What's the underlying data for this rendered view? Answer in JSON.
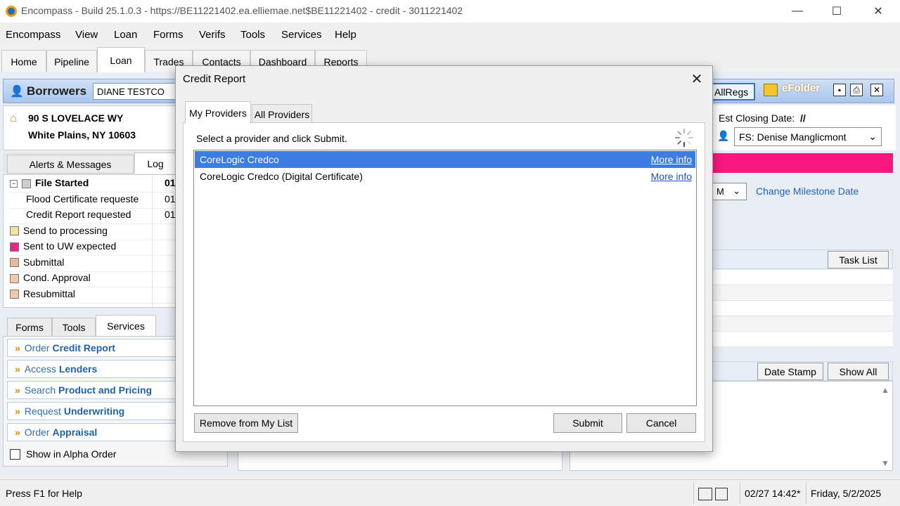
{
  "window": {
    "title": "Encompass - Build 25.1.0.3 - https://BE11221402.ea.elliemae.net$BE11221402 - credit - 3011221402",
    "minimize": "—",
    "maximize": "☐",
    "close": "✕"
  },
  "menu": [
    "Encompass",
    "View",
    "Loan",
    "Forms",
    "Verifs",
    "Tools",
    "Services",
    "Help"
  ],
  "tabs": [
    "Home",
    "Pipeline",
    "Loan",
    "Trades",
    "Contacts",
    "Dashboard",
    "Reports"
  ],
  "active_tab": "Loan",
  "borrowers": {
    "label": "Borrowers",
    "name": "DIANE TESTCO",
    "allregs": "AllRegs",
    "efolder": "eFolder"
  },
  "address": {
    "line1": "90 S LOVELACE WY",
    "line2": "White Plains, NY 10603"
  },
  "log_tabs": [
    "Alerts & Messages",
    "Log"
  ],
  "log_items": [
    {
      "label": "File Started",
      "date": "01",
      "color": "#cfcfcf",
      "bold": true
    },
    {
      "label": "Flood Certificate requeste",
      "date": "01",
      "color": ""
    },
    {
      "label": "Credit Report requested",
      "date": "01",
      "color": ""
    },
    {
      "label": "Send to processing",
      "date": "",
      "color": "#f1e3a0"
    },
    {
      "label": "Sent to UW expected",
      "date": "",
      "color": "#f0228a"
    },
    {
      "label": "Submittal",
      "date": "",
      "color": "#e8bb96"
    },
    {
      "label": "Cond. Approval",
      "date": "",
      "color": "#f1c8a8"
    },
    {
      "label": "Resubmittal",
      "date": "",
      "color": "#f1c8a8"
    }
  ],
  "bottom_tabs": [
    "Forms",
    "Tools",
    "Services"
  ],
  "services": [
    {
      "prefix": "Order ",
      "bold": "Credit Report"
    },
    {
      "prefix": "Access ",
      "bold": "Lenders"
    },
    {
      "prefix": "Search ",
      "bold": "Product and Pricing"
    },
    {
      "prefix": "Request ",
      "bold": "Underwriting"
    },
    {
      "prefix": "Order ",
      "bold": "Appraisal"
    }
  ],
  "show_alpha": "Show in Alpha Order",
  "right_panel": {
    "est_closing_label": "Est Closing Date:",
    "est_closing_value": "//",
    "fs_select": "FS: Denise Manglicmont",
    "milestone_select": "M",
    "change_milestone": "Change Milestone Date",
    "task_list": "Task List",
    "date_stamp": "Date Stamp",
    "show_all": "Show All"
  },
  "status": {
    "help": "Press F1 for Help",
    "timestamp": "02/27 14:42*",
    "date": "Friday, 5/2/2025"
  },
  "dialog": {
    "title": "Credit Report",
    "tabs": [
      "My Providers",
      "All Providers"
    ],
    "instruction": "Select a provider and click Submit.",
    "providers": [
      {
        "name": "CoreLogic Credco",
        "link": "More info",
        "selected": true
      },
      {
        "name": "CoreLogic Credco (Digital Certificate)",
        "link": "More info",
        "selected": false
      }
    ],
    "remove_button": "Remove from My List",
    "submit_button": "Submit",
    "cancel_button": "Cancel"
  },
  "colors": {
    "selection": "#3b7de3",
    "milestone_bar": "#f7197d",
    "link": "#1f62c6"
  }
}
